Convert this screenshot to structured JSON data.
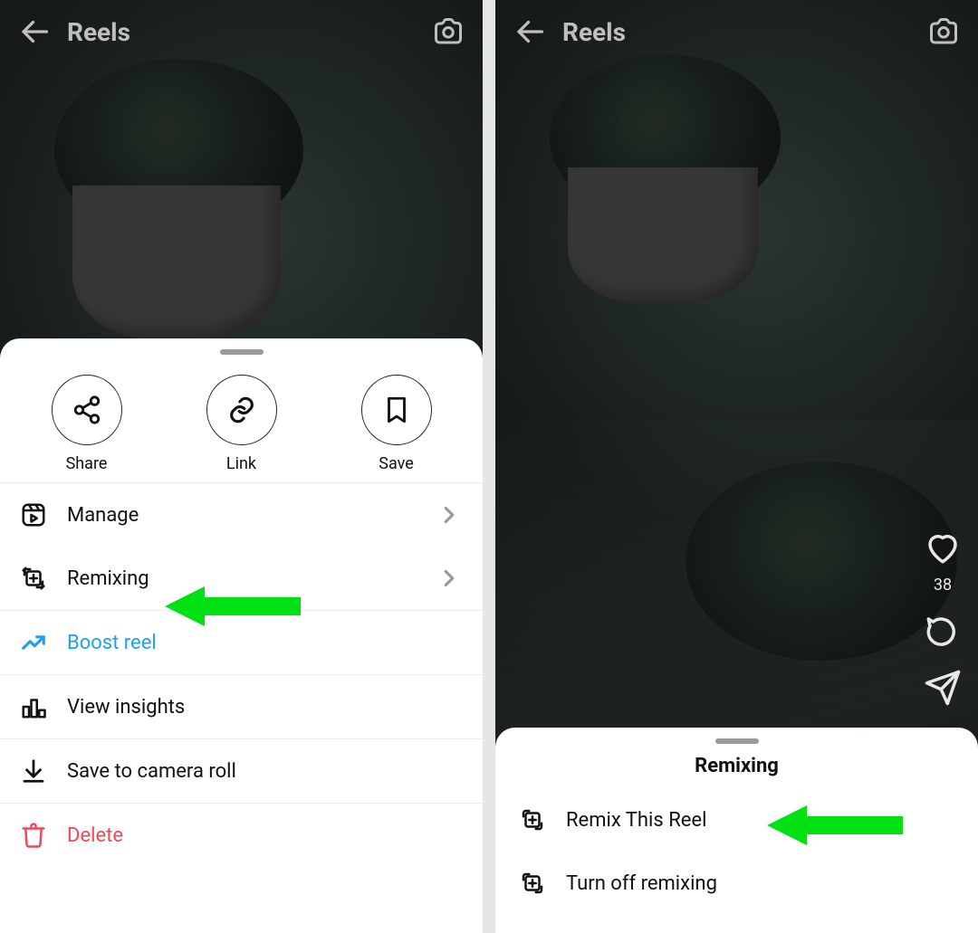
{
  "left": {
    "header_title": "Reels",
    "sheet": {
      "actions": {
        "share": "Share",
        "link": "Link",
        "save": "Save"
      },
      "rows": {
        "manage": "Manage",
        "remixing": "Remixing",
        "boost": "Boost reel",
        "insights": "View insights",
        "save_roll": "Save to camera roll",
        "delete": "Delete"
      }
    }
  },
  "right": {
    "header_title": "Reels",
    "likes_count": "38",
    "sheet": {
      "title": "Remixing",
      "rows": {
        "remix_this": "Remix This Reel",
        "turn_off": "Turn off remixing"
      }
    }
  },
  "colors": {
    "accent_arrow": "#00e012"
  }
}
